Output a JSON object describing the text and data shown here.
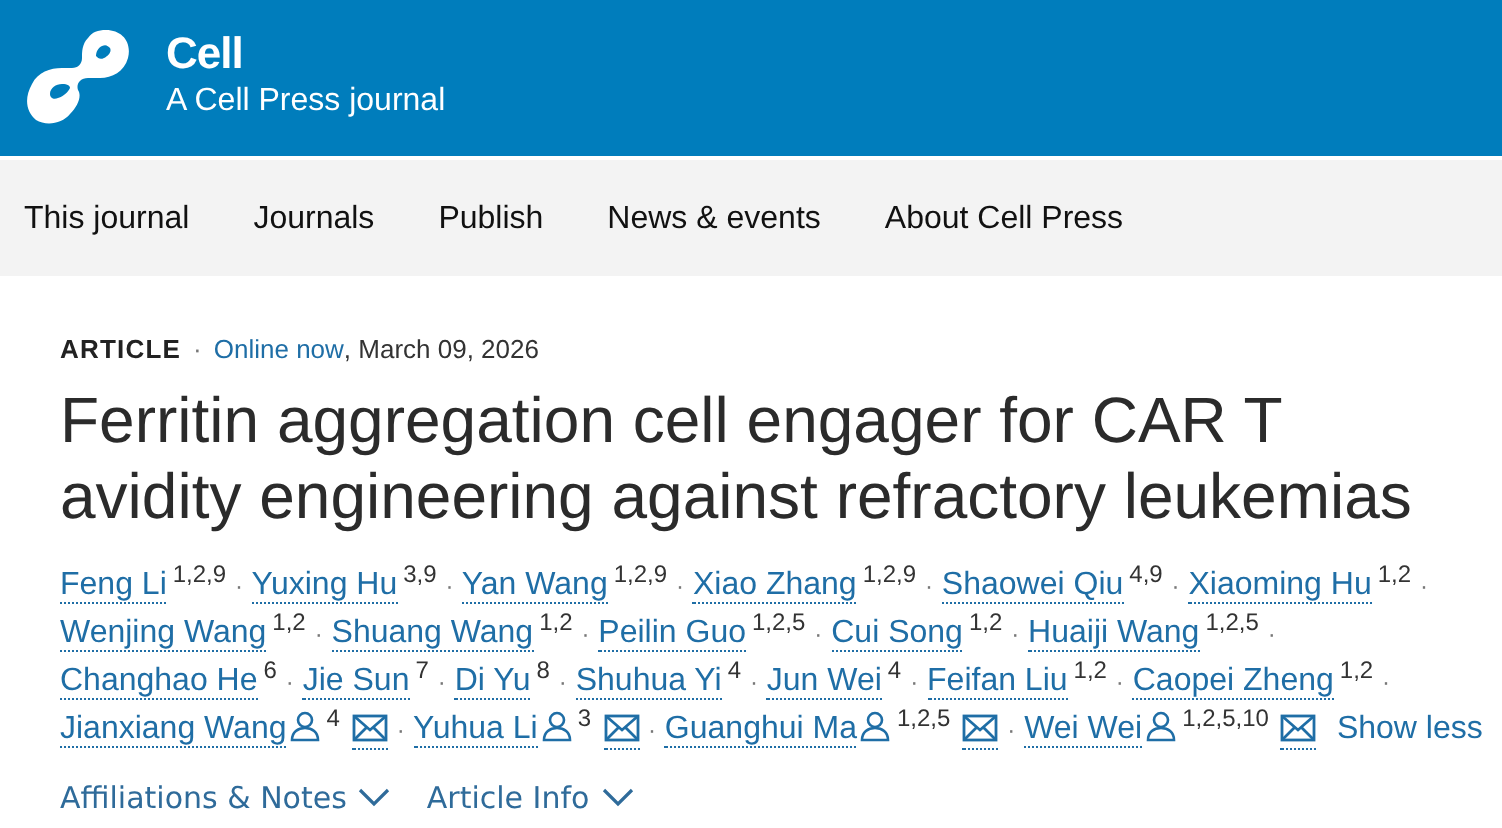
{
  "header": {
    "journal": "Cell",
    "tagline": "A Cell Press journal"
  },
  "nav": {
    "items": [
      "This journal",
      "Journals",
      "Publish",
      "News & events",
      "About Cell Press"
    ]
  },
  "article": {
    "type": "ARTICLE",
    "separator": "·",
    "status": "Online now",
    "date": ", March 09, 2026",
    "title": "Ferritin aggregation cell engager for CAR T avidity engineering against refractory leukemias"
  },
  "authors": {
    "separator": "·",
    "toggle": "Show less",
    "list": [
      {
        "name": "Feng Li",
        "affiliations": "1,2,9",
        "corresponding": false,
        "email": false
      },
      {
        "name": "Yuxing Hu",
        "affiliations": "3,9",
        "corresponding": false,
        "email": false
      },
      {
        "name": "Yan Wang",
        "affiliations": "1,2,9",
        "corresponding": false,
        "email": false
      },
      {
        "name": "Xiao Zhang",
        "affiliations": "1,2,9",
        "corresponding": false,
        "email": false
      },
      {
        "name": "Shaowei Qiu",
        "affiliations": "4,9",
        "corresponding": false,
        "email": false
      },
      {
        "name": "Xiaoming Hu",
        "affiliations": "1,2",
        "corresponding": false,
        "email": false
      },
      {
        "name": "Wenjing Wang",
        "affiliations": "1,2",
        "corresponding": false,
        "email": false
      },
      {
        "name": "Shuang Wang",
        "affiliations": "1,2",
        "corresponding": false,
        "email": false
      },
      {
        "name": "Peilin Guo",
        "affiliations": "1,2,5",
        "corresponding": false,
        "email": false
      },
      {
        "name": "Cui Song",
        "affiliations": "1,2",
        "corresponding": false,
        "email": false
      },
      {
        "name": "Huaiji Wang",
        "affiliations": "1,2,5",
        "corresponding": false,
        "email": false
      },
      {
        "name": "Changhao He",
        "affiliations": "6",
        "corresponding": false,
        "email": false
      },
      {
        "name": "Jie Sun",
        "affiliations": "7",
        "corresponding": false,
        "email": false
      },
      {
        "name": "Di Yu",
        "affiliations": "8",
        "corresponding": false,
        "email": false
      },
      {
        "name": "Shuhua Yi",
        "affiliations": "4",
        "corresponding": false,
        "email": false
      },
      {
        "name": "Jun Wei",
        "affiliations": "4",
        "corresponding": false,
        "email": false
      },
      {
        "name": "Feifan Liu",
        "affiliations": "1,2",
        "corresponding": false,
        "email": false
      },
      {
        "name": "Caopei Zheng",
        "affiliations": "1,2",
        "corresponding": false,
        "email": false
      },
      {
        "name": "Jianxiang Wang",
        "affiliations": "4",
        "corresponding": true,
        "email": true
      },
      {
        "name": "Yuhua Li",
        "affiliations": "3",
        "corresponding": true,
        "email": true
      },
      {
        "name": "Guanghui Ma",
        "affiliations": "1,2,5",
        "corresponding": true,
        "email": true
      },
      {
        "name": "Wei Wei",
        "affiliations": "1,2,5,10",
        "corresponding": true,
        "email": true
      }
    ]
  },
  "expanders": [
    {
      "label": "Affiliations & Notes",
      "expanded": false
    },
    {
      "label": "Article Info",
      "expanded": false
    }
  ]
}
